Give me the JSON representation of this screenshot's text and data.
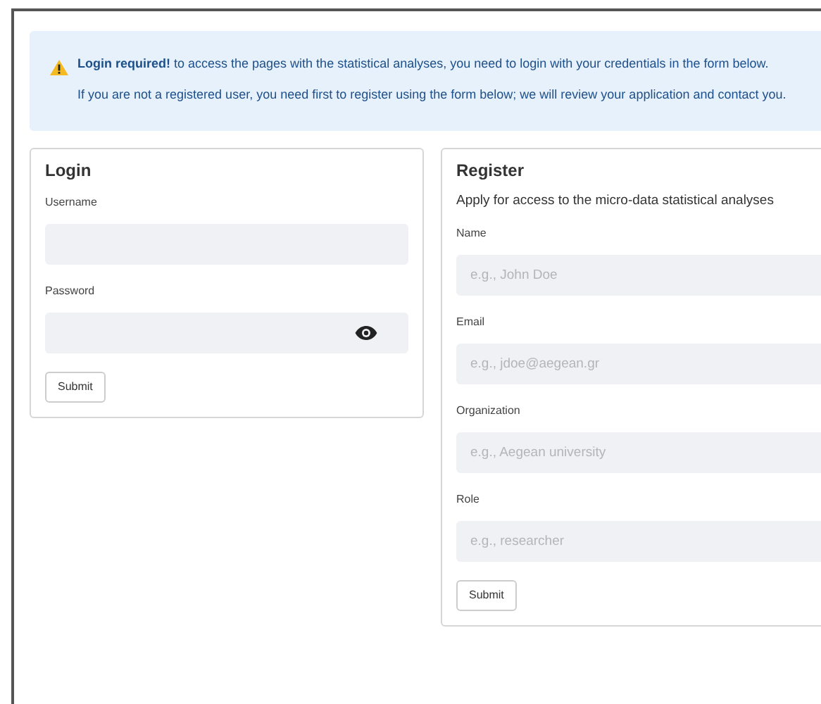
{
  "alert": {
    "paragraphs": [
      "**Login required!** to access the pages with the statistical analyses, you need to login with your credentials in the form below.",
      "If you are not a registered user, you need first to register using the form below; we will review your application and contact you."
    ]
  },
  "login": {
    "title": "Login",
    "fields": [
      {
        "label": "Username",
        "kind": "text"
      },
      {
        "label": "Password",
        "kind": "password"
      }
    ],
    "button": "Submit"
  },
  "register": {
    "title": "Register",
    "subtitle": "Apply for access to the micro-data statistical analyses",
    "fields": [
      {
        "label": "Name",
        "placeholder": "e.g., John Doe"
      },
      {
        "label": "Email",
        "placeholder": "e.g., jdoe@aegean.gr"
      },
      {
        "label": "Organization",
        "placeholder": "e.g., Aegean university"
      },
      {
        "label": "Role",
        "placeholder": "e.g., researcher"
      }
    ],
    "button": "Submit"
  }
}
